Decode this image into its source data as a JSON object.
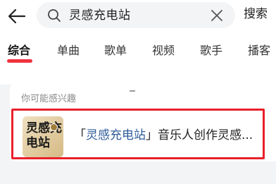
{
  "search": {
    "query": "灵感充电站",
    "submit_label": "搜索"
  },
  "tabs": [
    {
      "label": "综合",
      "active": true
    },
    {
      "label": "单曲",
      "active": false
    },
    {
      "label": "歌单",
      "active": false
    },
    {
      "label": "视频",
      "active": false
    },
    {
      "label": "歌手",
      "active": false
    },
    {
      "label": "播客",
      "active": false
    }
  ],
  "suggestion": {
    "header": "你可能感兴趣",
    "item": {
      "cover_text": "灵感充电站",
      "title_open": "「",
      "title_highlight": "灵感充电站",
      "title_close": "」",
      "title_rest": "音乐人创作灵感..."
    }
  },
  "colors": {
    "accent": "#f0343f",
    "highlight_text": "#2f5c9a",
    "selection_border": "#e8202a"
  },
  "icons": [
    "back-arrow-icon",
    "search-icon",
    "clear-icon"
  ]
}
